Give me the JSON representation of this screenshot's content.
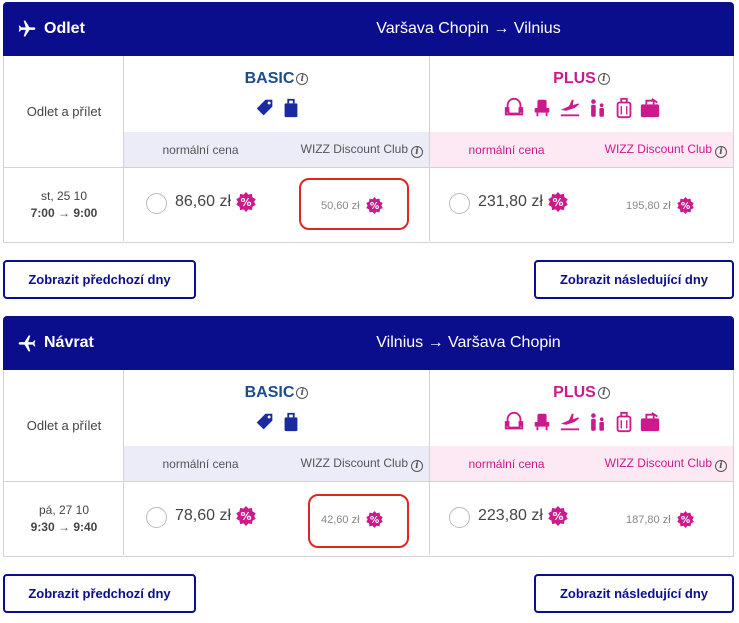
{
  "outbound": {
    "direction_label": "Odlet",
    "route": "Varšava Chopin → Vilnius",
    "row_header": "Odlet a přílet",
    "basic": {
      "title": "BASIC",
      "normal_label": "normální cena",
      "club_label": "WIZZ Discount Club"
    },
    "plus": {
      "title": "PLUS",
      "normal_label": "normální cena",
      "club_label": "WIZZ Discount Club"
    },
    "flight": {
      "date": "st, 25 10",
      "time": "7:00 → 9:00",
      "basic_price": "86,60 zł",
      "basic_club_price": "50,60 zł",
      "plus_price": "231,80 zł",
      "plus_club_price": "195,80 zł"
    },
    "prev_button": "Zobrazit předchozí dny",
    "next_button": "Zobrazit následující dny"
  },
  "return": {
    "direction_label": "Návrat",
    "route": "Vilnius → Varšava Chopin",
    "row_header": "Odlet a přílet",
    "basic": {
      "title": "BASIC",
      "normal_label": "normální cena",
      "club_label": "WIZZ Discount Club"
    },
    "plus": {
      "title": "PLUS",
      "normal_label": "normální cena",
      "club_label": "WIZZ Discount Club"
    },
    "flight": {
      "date": "pá, 27 10",
      "time": "9:30 → 9:40",
      "basic_price": "78,60 zł",
      "basic_club_price": "42,60 zł",
      "plus_price": "223,80 zł",
      "plus_club_price": "187,80 zł"
    },
    "prev_button": "Zobrazit předchozí dny",
    "next_button": "Zobrazit následující dny"
  },
  "icons": {
    "header": "airplane-icon",
    "info": "info-icon",
    "discount_badge": "percent-badge-icon",
    "basic": [
      "tag-icon",
      "bag-icon"
    ],
    "plus": [
      "seat-icon",
      "extra-legroom-icon",
      "checkin-icon",
      "family-icon",
      "trolley-bag-icon",
      "checked-bag-icon"
    ]
  },
  "info_glyph": "i",
  "colors": {
    "header_bg": "#0b0e8c",
    "basic_accent": "#1b4d8e",
    "plus_accent": "#cc1a8d",
    "basic_sub_bg": "#ececf9",
    "plus_sub_bg": "#fde9f3",
    "highlight": "#e02525"
  }
}
